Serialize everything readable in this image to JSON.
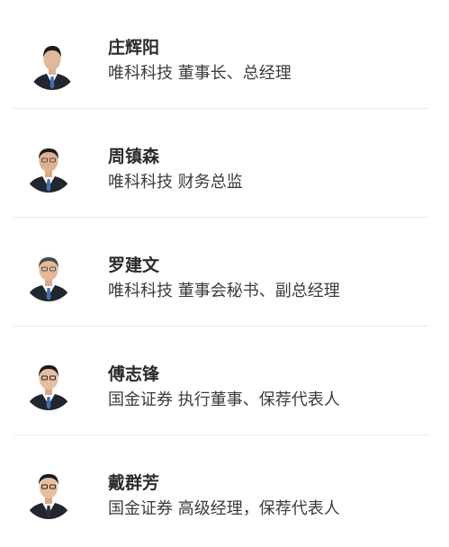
{
  "people": [
    {
      "name": "庄辉阳",
      "title": "唯科科技 董事长、总经理"
    },
    {
      "name": "周镇森",
      "title": "唯科科技 财务总监"
    },
    {
      "name": "罗建文",
      "title": "唯科科技 董事会秘书、副总经理"
    },
    {
      "name": "傅志锋",
      "title": "国金证券 执行董事、保荐代表人"
    },
    {
      "name": "戴群芳",
      "title": "国金证券 高级经理，保荐代表人"
    }
  ],
  "colors": {
    "suit": "#22262e",
    "shirt": "#ffffff",
    "tie": "#3f6fb5",
    "skin": "#e2b89a",
    "hair": "#1b1b1b",
    "divider": "#ececec"
  }
}
